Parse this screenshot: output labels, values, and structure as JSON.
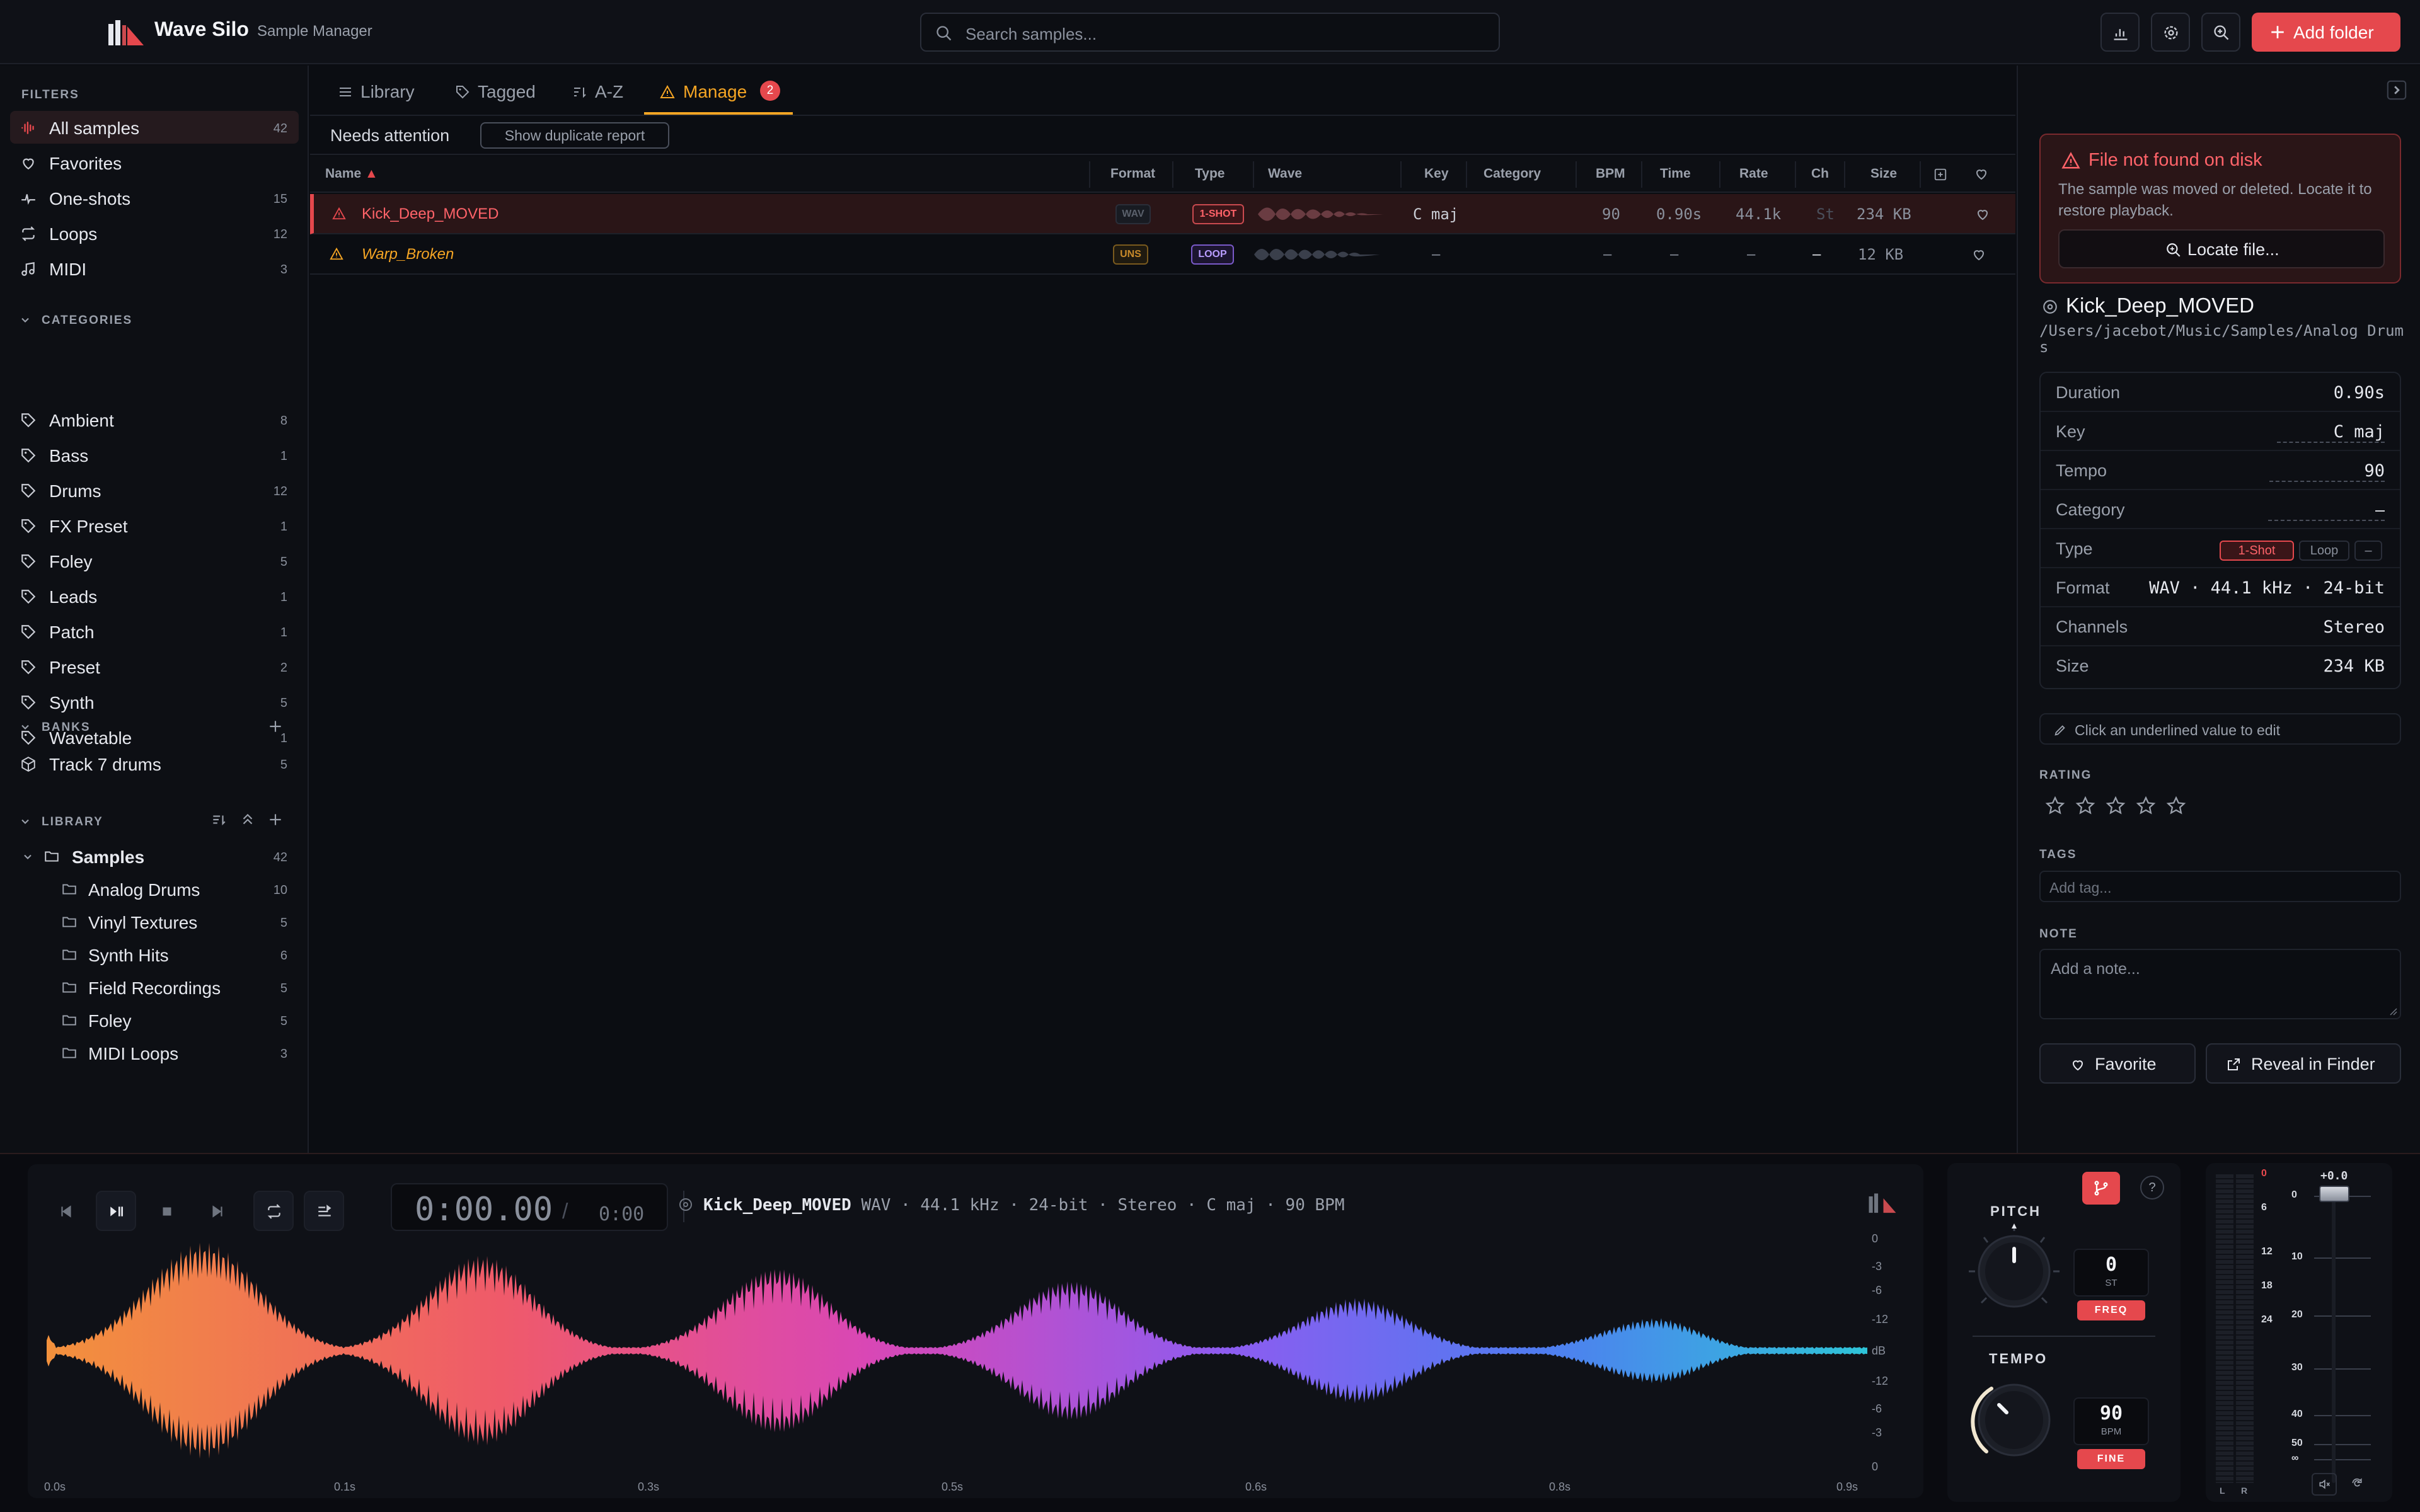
{
  "app": {
    "name": "Wave Silo",
    "subtitle": "Sample Manager"
  },
  "search": {
    "placeholder": "Search samples..."
  },
  "toolbar": {
    "add_folder_label": "Add folder"
  },
  "sidebar": {
    "filters_heading": "FILTERS",
    "filters": [
      {
        "label": "All samples",
        "count": "42",
        "icon": "waveform-icon"
      },
      {
        "label": "Favorites",
        "count": "",
        "icon": "heart-icon"
      },
      {
        "label": "One-shots",
        "count": "15",
        "icon": "oneshot-icon"
      },
      {
        "label": "Loops",
        "count": "12",
        "icon": "loop-icon"
      },
      {
        "label": "MIDI",
        "count": "3",
        "icon": "music-note-icon"
      }
    ],
    "categories_heading": "CATEGORIES",
    "categories": [
      {
        "label": "Ambient",
        "count": "8"
      },
      {
        "label": "Bass",
        "count": "1"
      },
      {
        "label": "Drums",
        "count": "12"
      },
      {
        "label": "FX Preset",
        "count": "1"
      },
      {
        "label": "Foley",
        "count": "5"
      },
      {
        "label": "Leads",
        "count": "1"
      },
      {
        "label": "Patch",
        "count": "1"
      },
      {
        "label": "Preset",
        "count": "2"
      },
      {
        "label": "Synth",
        "count": "5"
      },
      {
        "label": "Wavetable",
        "count": "1"
      }
    ],
    "banks_heading": "BANKS",
    "banks": [
      {
        "label": "Track 7 drums",
        "count": "5"
      }
    ],
    "library_heading": "LIBRARY",
    "library_root": {
      "label": "Samples",
      "count": "42"
    },
    "library_folders": [
      {
        "label": "Analog Drums",
        "count": "10"
      },
      {
        "label": "Vinyl Textures",
        "count": "5"
      },
      {
        "label": "Synth Hits",
        "count": "6"
      },
      {
        "label": "Field Recordings",
        "count": "5"
      },
      {
        "label": "Foley",
        "count": "5"
      },
      {
        "label": "MIDI Loops",
        "count": "3"
      }
    ]
  },
  "tabs": [
    {
      "label": "Library"
    },
    {
      "label": "Tagged"
    },
    {
      "label": "A-Z"
    },
    {
      "label": "Manage",
      "badge": "2"
    }
  ],
  "subbar": {
    "title": "Needs attention",
    "dup_button": "Show duplicate report"
  },
  "table": {
    "headers": {
      "name": "Name",
      "format": "Format",
      "type": "Type",
      "wave": "Wave",
      "key": "Key",
      "category": "Category",
      "bpm": "BPM",
      "time": "Time",
      "rate": "Rate",
      "ch": "Ch",
      "size": "Size"
    },
    "rows": [
      {
        "name": "Kick_Deep_MOVED",
        "format": "WAV",
        "type": "1-SHOT",
        "key": "C maj",
        "category": "",
        "bpm": "90",
        "time": "0.90s",
        "rate": "44.1k",
        "ch": "St",
        "size": "234 KB"
      },
      {
        "name": "Warp_Broken",
        "format": "UNS",
        "type": "LOOP",
        "key": "–",
        "category": "",
        "bpm": "–",
        "time": "–",
        "rate": "–",
        "ch": "–",
        "size": "12 KB"
      }
    ]
  },
  "details": {
    "alert_title": "File not found on disk",
    "alert_text": "The sample was moved or deleted. Locate it to restore playback.",
    "locate_button": "Locate file...",
    "name": "Kick_Deep_MOVED",
    "path": "/Users/jacebot/Music/Samples/Analog Drums",
    "props": {
      "duration_label": "Duration",
      "duration": "0.90s",
      "key_label": "Key",
      "key": "C maj",
      "tempo_label": "Tempo",
      "tempo": "90",
      "category_label": "Category",
      "category": "–",
      "type_label": "Type",
      "type_options": [
        "1-Shot",
        "Loop",
        "–"
      ],
      "type_selected": "1-Shot",
      "format_label": "Format",
      "format": "WAV · 44.1 kHz · 24-bit",
      "channels_label": "Channels",
      "channels": "Stereo",
      "size_label": "Size",
      "size": "234 KB"
    },
    "edit_hint": "Click an underlined value to edit",
    "rating_label": "RATING",
    "rating": 0,
    "tags_label": "TAGS",
    "tags_placeholder": "Add tag...",
    "note_label": "NOTE",
    "note_placeholder": "Add a note...",
    "favorite_button": "Favorite",
    "reveal_button": "Reveal in Finder"
  },
  "player": {
    "time_current": "0:00.00",
    "time_sep": "/",
    "time_total": "0:00",
    "track_name": "Kick_Deep_MOVED",
    "track_meta": "WAV · 44.1 kHz · 24-bit · Stereo · C maj · 90 BPM",
    "db_labels": [
      "0",
      "-3",
      "-6",
      "-12",
      "dB",
      "-12",
      "-6",
      "-3",
      "0"
    ],
    "time_labels": [
      "0.0s",
      "0.1s",
      "0.3s",
      "0.5s",
      "0.6s",
      "0.8s",
      "0.9s"
    ],
    "pitch_label": "PITCH",
    "pitch_value": "0",
    "pitch_unit": "ST",
    "pitch_mode": "FREQ",
    "tempo_label": "TEMPO",
    "tempo_value": "90",
    "tempo_unit": "BPM",
    "tempo_mode": "FINE",
    "help": "?",
    "gain_readout": "+0.0",
    "meter_scale": [
      "0",
      "6",
      "12",
      "18",
      "24"
    ],
    "fader_scale": [
      "0",
      "10",
      "20",
      "30",
      "40",
      "50",
      "∞"
    ],
    "channel_l": "L",
    "channel_r": "R"
  },
  "colors": {
    "accent": "#e5484d",
    "warning": "#f5a524",
    "bg": "#0b0d12"
  }
}
